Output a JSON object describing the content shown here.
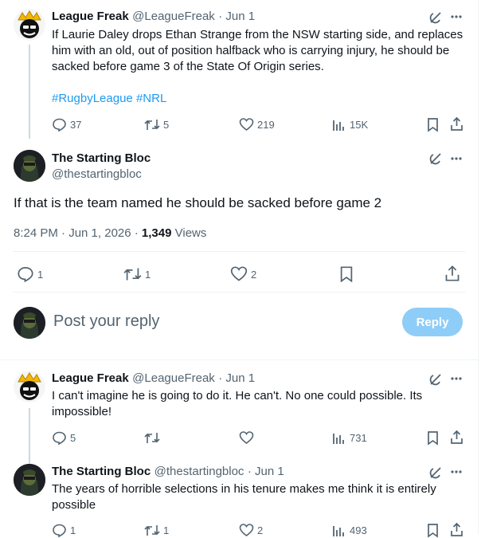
{
  "tweets": [
    {
      "display_name": "League Freak",
      "handle": "@LeagueFreak",
      "date": "· Jun 1",
      "text": "If Laurie Daley drops Ethan Strange from the NSW starting side, and replaces him with an old, out of position halfback who is carrying injury, he should be sacked before game 3 of the State Of Origin series.",
      "hashtags": [
        "#RugbyLeague",
        "#NRL"
      ],
      "replies": "37",
      "retweets": "5",
      "likes": "219",
      "views": "15K"
    },
    {
      "display_name": "League Freak",
      "handle": "@LeagueFreak",
      "date": "· Jun 1",
      "text": "I can't imagine he is going to do it. He can't. No one could possible. Its impossible!",
      "replies": "5",
      "retweets": "",
      "likes": "",
      "views": "731"
    },
    {
      "display_name": "The Starting Bloc",
      "handle": "@thestartingbloc",
      "date": "· Jun 1",
      "text": "The years of horrible selections in his tenure makes me think it is entirely possible",
      "replies": "1",
      "retweets": "1",
      "likes": "2",
      "views": "493"
    }
  ],
  "main_tweet": {
    "display_name": "The Starting Bloc",
    "handle": "@thestartingbloc",
    "text": "If that is the team named he should be sacked before game 2",
    "time": "8:24 PM · Jun 1, 2026 · ",
    "views_count": "1,349",
    "views_label": " Views",
    "replies": "1",
    "retweets": "1",
    "likes": "2"
  },
  "composer": {
    "placeholder": "Post your reply",
    "button_label": "Reply"
  },
  "colors": {
    "accent": "#1d9bf0",
    "text": "#0f1419",
    "muted": "#536471",
    "reply_button_disabled": "#8ecdf8"
  },
  "icons": [
    "grok-icon",
    "more-icon",
    "reply-icon",
    "retweet-icon",
    "like-icon",
    "views-icon",
    "bookmark-icon",
    "share-icon"
  ]
}
